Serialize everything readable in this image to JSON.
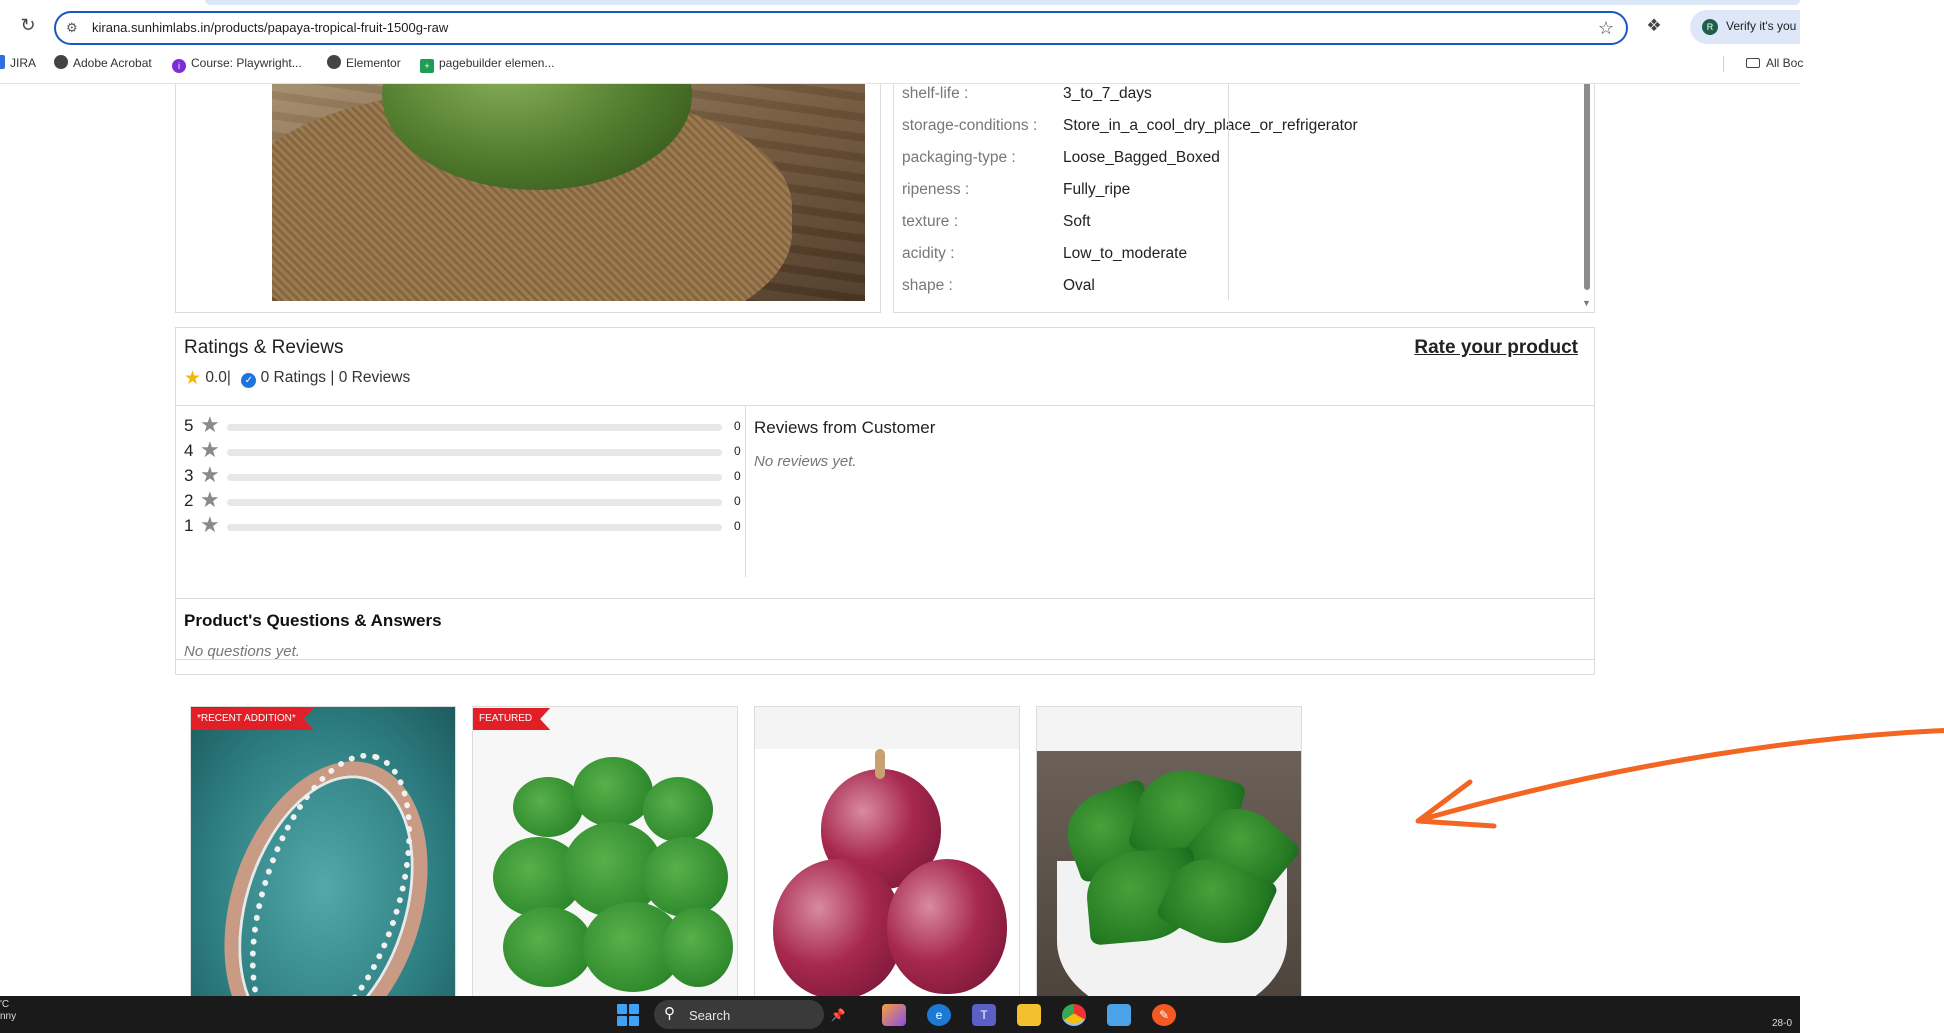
{
  "browser": {
    "url": "kirana.sunhimlabs.in/products/papaya-tropical-fruit-1500g-raw",
    "verify_label": "Verify it's you",
    "bookmarks": [
      {
        "label": "JIRA",
        "color": "#2f6fdf"
      },
      {
        "label": "Adobe Acrobat",
        "color": "#444444"
      },
      {
        "label": "Course: Playwright...",
        "color": "#7b2ed6"
      },
      {
        "label": "Elementor",
        "color": "#444444"
      },
      {
        "label": "pagebuilder elemen...",
        "color": "#1f9d55"
      }
    ],
    "all_bookmarks_label": "All Boc"
  },
  "specs": [
    {
      "key": "shelf-life :",
      "value": "3_to_7_days"
    },
    {
      "key": "storage-conditions :",
      "value": "Store_in_a_cool_dry_place_or_refrigerator"
    },
    {
      "key": "packaging-type :",
      "value": "Loose_Bagged_Boxed"
    },
    {
      "key": "ripeness :",
      "value": "Fully_ripe"
    },
    {
      "key": "texture :",
      "value": "Soft"
    },
    {
      "key": "acidity :",
      "value": "Low_to_moderate"
    },
    {
      "key": "shape :",
      "value": "Oval"
    }
  ],
  "ratings": {
    "title": "Ratings & Reviews",
    "rate_link": "Rate your product",
    "average": "0.0",
    "summary": "0 Ratings | 0 Reviews",
    "bars": [
      {
        "stars": "5",
        "count": "0",
        "fill": 0
      },
      {
        "stars": "4",
        "count": "0",
        "fill": 0
      },
      {
        "stars": "3",
        "count": "0",
        "fill": 0
      },
      {
        "stars": "2",
        "count": "0",
        "fill": 0
      },
      {
        "stars": "1",
        "count": "0",
        "fill": 0
      }
    ],
    "reviews_title": "Reviews from Customer",
    "reviews_empty": "No reviews yet."
  },
  "qa": {
    "title": "Product's Questions & Answers",
    "empty": "No questions yet."
  },
  "cards": [
    {
      "badge": "*RECENT ADDITION*"
    },
    {
      "badge": "FEATURED"
    },
    {
      "badge": ""
    },
    {
      "badge": ""
    }
  ],
  "taskbar": {
    "left_line1": "'C",
    "left_line2": "nny",
    "search_label": "Search",
    "date": "28-0"
  },
  "colors": {
    "accent_orange": "#f26522",
    "badge_red": "#e21f26",
    "star_yellow": "#f5b800",
    "omnibox_blue": "#1a56c4"
  }
}
